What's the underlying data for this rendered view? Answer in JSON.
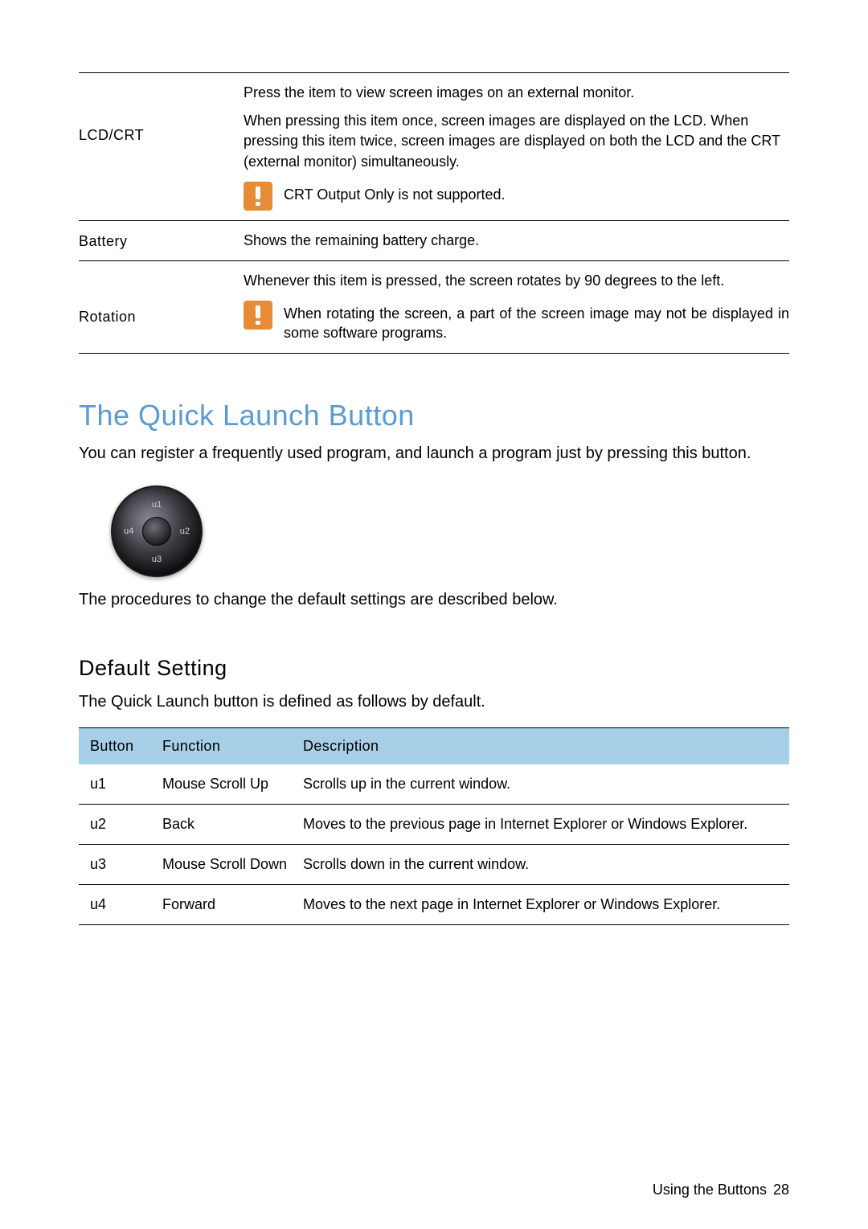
{
  "upper": {
    "rows": [
      {
        "label": "LCD/CRT",
        "text1": "Press the item to view screen images on an external monitor.",
        "text2": "When pressing this item once, screen images are displayed on the LCD. When pressing this item twice, screen images are displayed on both the LCD and the CRT (external monitor) simultaneously.",
        "note": "CRT Output Only is not supported."
      },
      {
        "label": "Battery",
        "text1": "Shows the remaining battery charge."
      },
      {
        "label": "Rotation",
        "text1": "Whenever this item is pressed, the screen rotates by 90 degrees to the left.",
        "note": "When rotating the screen, a part of the screen image may not be displayed in some software programs."
      }
    ]
  },
  "section_title": "The Quick Launch Button",
  "section_body1": "You can register a frequently used program, and launch a program just by pressing this button.",
  "circle_labels": {
    "u1": "u1",
    "u2": "u2",
    "u3": "u3",
    "u4": "u4"
  },
  "section_body2": "The procedures to change the default settings are described below.",
  "subsection_title": "Default Setting",
  "subsection_body": "The Quick Launch button is defined as follows by default.",
  "lower": {
    "headers": {
      "button": "Button",
      "function": "Function",
      "description": "Description"
    },
    "rows": [
      {
        "button": "u1",
        "function": "Mouse Scroll Up",
        "description": "Scrolls up in the current window."
      },
      {
        "button": "u2",
        "function": "Back",
        "description": "Moves to the previous page in Internet Explorer or Windows Explorer."
      },
      {
        "button": "u3",
        "function": "Mouse Scroll Down",
        "description": "Scrolls down in the current window."
      },
      {
        "button": "u4",
        "function": "Forward",
        "description": "Moves to the next page in Internet Explorer or Windows Explorer."
      }
    ]
  },
  "footer": {
    "text": "Using the Buttons",
    "page": "28"
  }
}
